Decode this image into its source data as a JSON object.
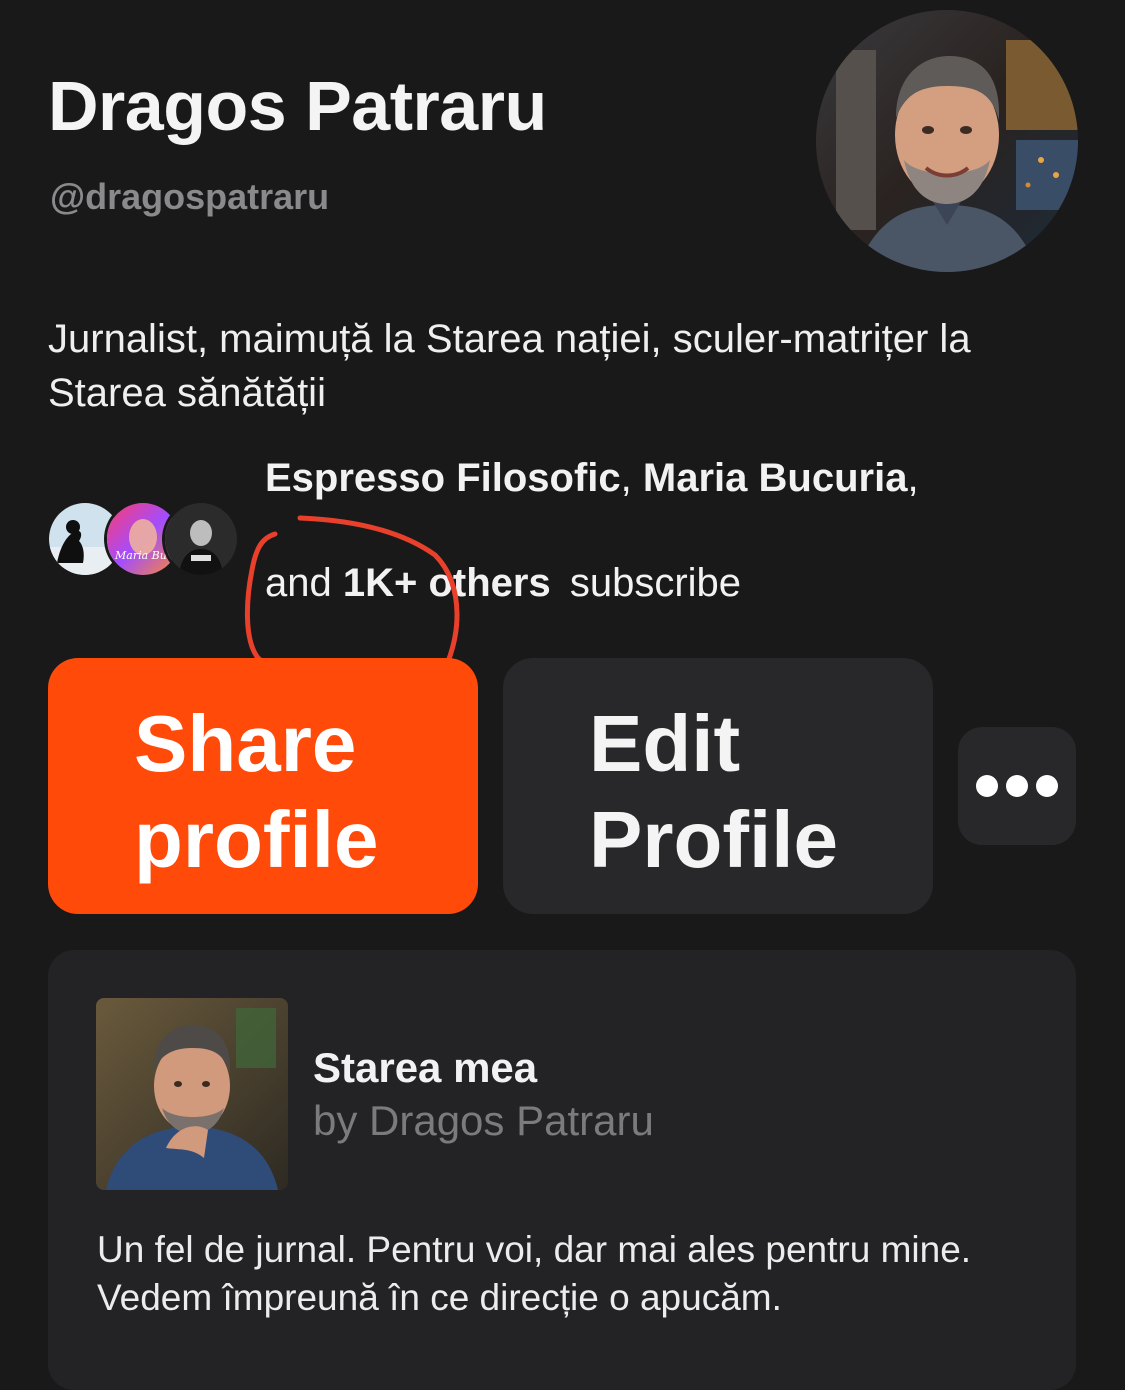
{
  "profile": {
    "name": "Dragos Patraru",
    "handle": "@dragospatraru",
    "bio": "Jurnalist, maimuță la Starea nației, sculer-matrițer la Starea sănătății"
  },
  "subscribers": {
    "names": [
      "Espresso Filosofic",
      "Maria Bucuria"
    ],
    "and_label": "and",
    "others_label": "1K+ others",
    "subscribe_label": "subscribe",
    "avatar_text": "Maria Buc"
  },
  "actions": {
    "share_label": "Share profile",
    "edit_label": "Edit Profile",
    "more_icon": "more-horizontal-icon"
  },
  "publication": {
    "title": "Starea mea",
    "author": "by Dragos Patraru",
    "description": "Un fel de jurnal. Pentru voi, dar mai ales pentru mine. Vedem împreună în ce direcție o apucăm."
  },
  "colors": {
    "background": "#19191a",
    "accent": "#ff4a0a",
    "button_secondary": "#28282a",
    "card": "#232325",
    "muted_text": "#8a8a8c",
    "annotation": "#e8402a"
  }
}
